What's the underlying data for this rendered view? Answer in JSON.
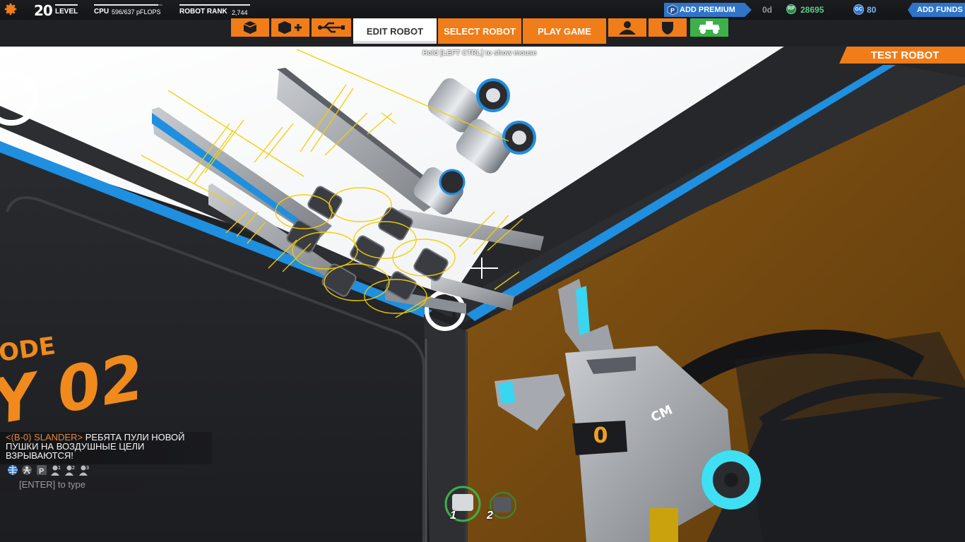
{
  "player": {
    "level_number": "20",
    "level_label": "LEVEL",
    "cpu_label": "CPU",
    "cpu_value": "596/637 pFLOPS",
    "cpu_fraction": 0.936,
    "rank_label": "ROBOT RANK",
    "rank_value": "2,744"
  },
  "currency": {
    "premium_label": "ADD PREMIUM",
    "premium_days": "0d",
    "rp_icon": "RP",
    "rp_value": "28695",
    "gc_icon": "GC",
    "gc_value": "80",
    "funds_label": "ADD FUNDS"
  },
  "tabs": {
    "icon_tabs_left": [
      "cube-icon",
      "cube-plus-icon",
      "usb-icon"
    ],
    "edit": "EDIT ROBOT",
    "select": "SELECT ROBOT",
    "play": "PLAY GAME",
    "icon_tabs_right": [
      "profile-icon",
      "clan-shield-icon",
      "garage-robot-icon"
    ]
  },
  "hint": "Hold [LEFT CTRL] to show mouse",
  "test_robot": "TEST ROBOT",
  "wall_text": {
    "line1": "ODE",
    "line2": "Y 02"
  },
  "chat": {
    "sender": "<(B-0) SLANDER>",
    "message": " РЕБЯТА ПУЛИ НОВОЙ ПУШКИ НА ВОЗДУШНЫЕ ЦЕЛИ ВЗРЫВАЮТСЯ!",
    "icons": [
      "globe-icon",
      "pilot-icon",
      "party-icon",
      "team1-icon",
      "team2-icon",
      "team3-icon"
    ],
    "input_placeholder": "[ENTER] to type"
  },
  "hotbar": {
    "slot1": "1",
    "slot2": "2"
  },
  "cube_counter": "0",
  "gun_label": "CM",
  "colors": {
    "accent_orange": "#f07d19",
    "premium_blue": "#2f74c8",
    "rp_green": "#5fc78b",
    "garage_green": "#3db04a",
    "garage_floor": "#7a4d12",
    "wall_stripe": "#1f8fe0"
  }
}
